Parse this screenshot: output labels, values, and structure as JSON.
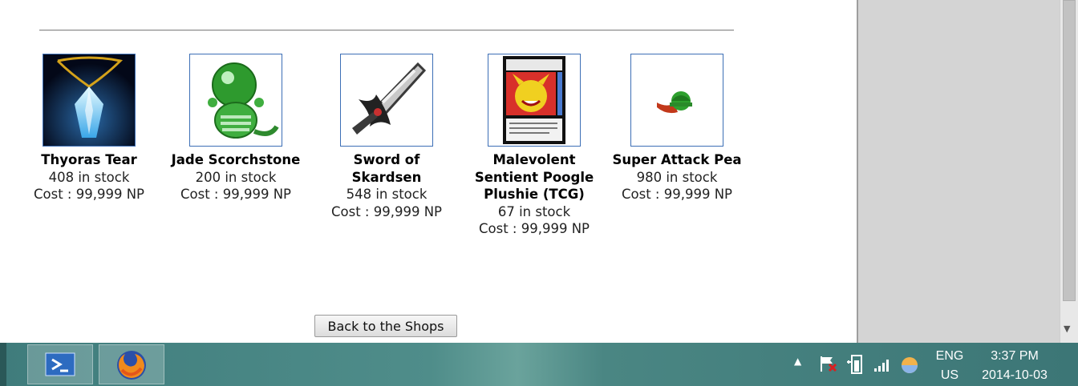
{
  "items": [
    {
      "name": "Thyoras Tear",
      "stock": "408 in stock",
      "cost": "Cost : 99,999 NP"
    },
    {
      "name": "Jade Scorchstone",
      "stock": "200 in stock",
      "cost": "Cost : 99,999 NP"
    },
    {
      "name": "Sword of Skardsen",
      "stock": "548 in stock",
      "cost": "Cost : 99,999 NP"
    },
    {
      "name": "Malevolent Sentient Poogle Plushie (TCG)",
      "stock": "67 in stock",
      "cost": "Cost : 99,999 NP"
    },
    {
      "name": "Super Attack Pea",
      "stock": "980 in stock",
      "cost": "Cost : 99,999 NP"
    }
  ],
  "back_button": "Back to the Shops",
  "taskbar": {
    "language_top": "ENG",
    "language_bottom": "US",
    "time": "3:37 PM",
    "date": "2014-10-03"
  },
  "colors": {
    "thumb_border": "#3d6fb6",
    "taskbar": "#4f8d8a"
  }
}
